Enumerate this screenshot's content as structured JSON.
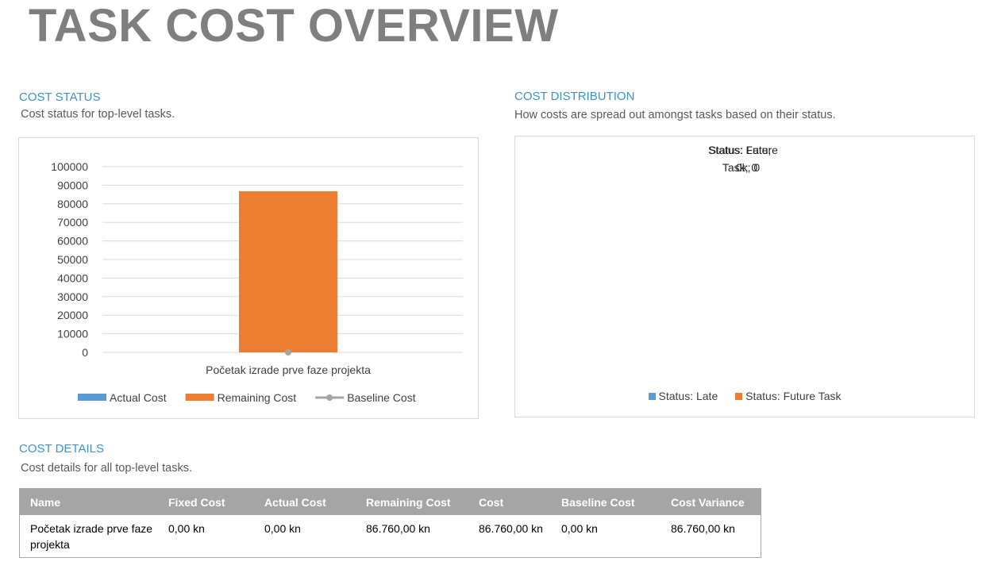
{
  "page_title": "TASK COST OVERVIEW",
  "cost_status": {
    "heading": "COST STATUS",
    "description": "Cost status for top-level tasks."
  },
  "cost_distribution": {
    "heading": "COST DISTRIBUTION",
    "description": "How costs are spread out amongst tasks based on their status.",
    "overlapping_labels": [
      {
        "line1": "Status: Late;",
        "line2": "Task; 0"
      },
      {
        "line1": "Status: Future",
        "line2": "0k; 0"
      }
    ],
    "legend": [
      {
        "label": "Status: Late",
        "color": "#5b9bd5"
      },
      {
        "label": "Status: Future Task",
        "color": "#ed7d31"
      }
    ]
  },
  "cost_details": {
    "heading": "COST DETAILS",
    "description": "Cost details for all top-level tasks.",
    "columns": [
      "Name",
      "Fixed Cost",
      "Actual Cost",
      "Remaining Cost",
      "Cost",
      "Baseline Cost",
      "Cost Variance"
    ],
    "rows": [
      [
        "Početak izrade prve faze projekta",
        "0,00 kn",
        "0,00 kn",
        "86.760,00 kn",
        "86.760,00 kn",
        "0,00 kn",
        "86.760,00 kn"
      ]
    ]
  },
  "chart_data": {
    "type": "bar",
    "categories": [
      "Početak izrade prve faze projekta"
    ],
    "series": [
      {
        "name": "Actual Cost",
        "values": [
          0
        ],
        "color": "#5b9bd5",
        "kind": "bar"
      },
      {
        "name": "Remaining Cost",
        "values": [
          86760
        ],
        "color": "#ed7d31",
        "kind": "bar"
      },
      {
        "name": "Baseline Cost",
        "values": [
          0
        ],
        "color": "#a5a5a5",
        "kind": "line"
      }
    ],
    "yticks": [
      "0",
      "10000",
      "20000",
      "30000",
      "40000",
      "50000",
      "60000",
      "70000",
      "80000",
      "90000",
      "100000"
    ],
    "ylim": [
      0,
      100000
    ],
    "stacked": true,
    "grid": true,
    "legend_position": "bottom"
  }
}
